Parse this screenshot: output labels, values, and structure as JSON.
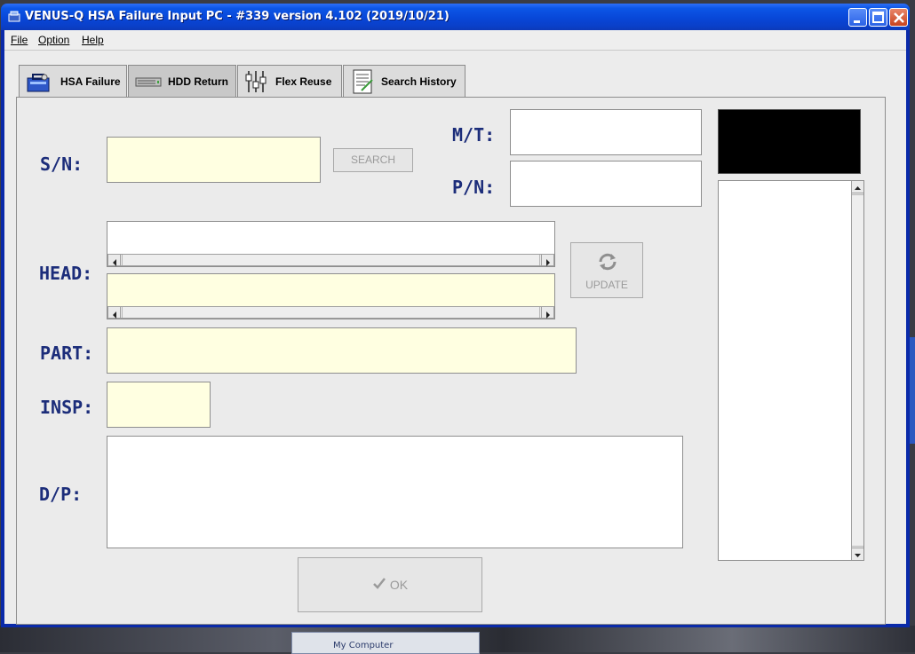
{
  "window": {
    "title": "VENUS-Q HSA Failure Input PC - #339 version 4.102 (2019/10/21)"
  },
  "menu": {
    "items": [
      {
        "label": "File"
      },
      {
        "label": "Option"
      },
      {
        "label": "Help"
      }
    ]
  },
  "tabs": [
    {
      "label": "HSA Failure",
      "icon": "hsa-toolbox-icon"
    },
    {
      "label": "HDD Return",
      "icon": "hard-drive-icon",
      "active": true
    },
    {
      "label": "Flex Reuse",
      "icon": "flex-cable-icon"
    },
    {
      "label": "Search History",
      "icon": "document-search-icon"
    }
  ],
  "form": {
    "sn_label": "S/N:",
    "sn_value": "",
    "search_button": "SEARCH",
    "mt_label": "M/T:",
    "mt_value": "",
    "pn_label": "P/N:",
    "pn_value": "",
    "head_label": "HEAD:",
    "head_top_value": "",
    "head_bottom_value": "",
    "update_button": "UPDATE",
    "part_label": "PART:",
    "part_value": "",
    "insp_label": "INSP:",
    "insp_value": "",
    "dp_label": "D/P:",
    "dp_value": "",
    "ok_button": "OK"
  },
  "background": {
    "taskbar_fragment_text": "My Computer"
  },
  "colors": {
    "title_bar": "#0a56e6",
    "label_blue": "#1c2d7a",
    "input_yellow": "#ffffe1",
    "panel_gray": "#ebebeb"
  }
}
